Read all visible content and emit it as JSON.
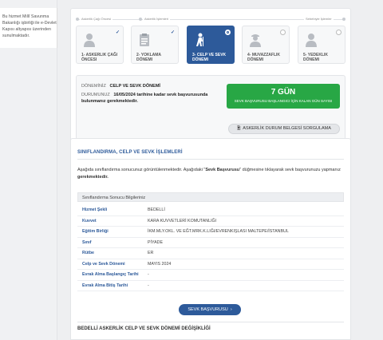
{
  "left_note": "Bu hizmet Millî Savunma Bakanlığı işbirliği ile e-Devlet Kapısı altyapısı üzerinden sunulmaktadır.",
  "stepbar": {
    "caption_1": "Askerlik Çağı Öncesi",
    "caption_2": "Askerlik İşlemleri",
    "caption_3": "Sebebiyle İşlemler"
  },
  "steps": [
    {
      "label": "1- Askerlik Çağı Öncesi",
      "icon": "person-icon",
      "state": "done"
    },
    {
      "label": "2- Yoklama Dönemi",
      "icon": "clipboard-icon",
      "state": "done"
    },
    {
      "label": "3- Celp ve Sevk Dönemi",
      "icon": "soldier-walking-icon",
      "state": "active"
    },
    {
      "label": "4- Muvazzaflık Dönemi",
      "icon": "soldier-icon",
      "state": "inactive"
    },
    {
      "label": "5- Yedeklik Dönemi",
      "icon": "reserve-icon",
      "state": "inactive"
    }
  ],
  "status": {
    "period_key": "DÖNEMİNİZ",
    "period_value": "CELP VE SEVK DÖNEMİ",
    "status_key": "DURUMUNUZ",
    "status_value": "16/05/2024 tarihine kadar sevk başvurusunda bulunmanız gerekmektedir.",
    "days": "7 GÜN",
    "days_caption": "SEVK BAŞVURUSU BAŞLANGICI İÇİN KALAN GÜN SAYISI",
    "doc_button": "ASKERLİK DURUM BELGESİ SORGULAMA"
  },
  "classification": {
    "title": "SINIFLANDIRMA, CELP VE SEVK İŞLEMLERİ",
    "intro_1": "Aşağıda sınıflandırma sonucunuz görüntülenmektedir. Aşağıdaki \"",
    "intro_link": "Sevk Başvurusu",
    "intro_2": "\" düğmesine tıklayarak sevk başvurunuzu yapmanız ",
    "intro_bold": "gerekmektedir.",
    "table_header": "Sınıflandırma Sonucu Bilgileriniz",
    "rows": [
      {
        "key": "Hizmet Şekli",
        "value": "BEDELLİ"
      },
      {
        "key": "Kuvvet",
        "value": "KARA KUVVETLERİ KOMUTANLIĞI"
      },
      {
        "key": "Eğitim Birliği",
        "value": "İKM.MLY.OKL. VE EĞT.MRK.K.LIĞI/EVRENKIŞLASI MALTEPE/İSTANBUL"
      },
      {
        "key": "Sınıf",
        "value": "PİYADE"
      },
      {
        "key": "Rütbe",
        "value": "ER"
      },
      {
        "key": "Celp ve Sevk Dönemi",
        "value": "MAYIS 2024"
      },
      {
        "key": "Evrak Alma Başlangıç Tarihi",
        "value": "-"
      },
      {
        "key": "Evrak Alma Bitiş Tarihi",
        "value": "-"
      }
    ],
    "submit_button": "SEVK BAŞVURUSU",
    "next_title": "BEDELLİ ASKERLİK CELP VE SEVK DÖNEMİ DEĞİŞİKLİĞİ"
  }
}
